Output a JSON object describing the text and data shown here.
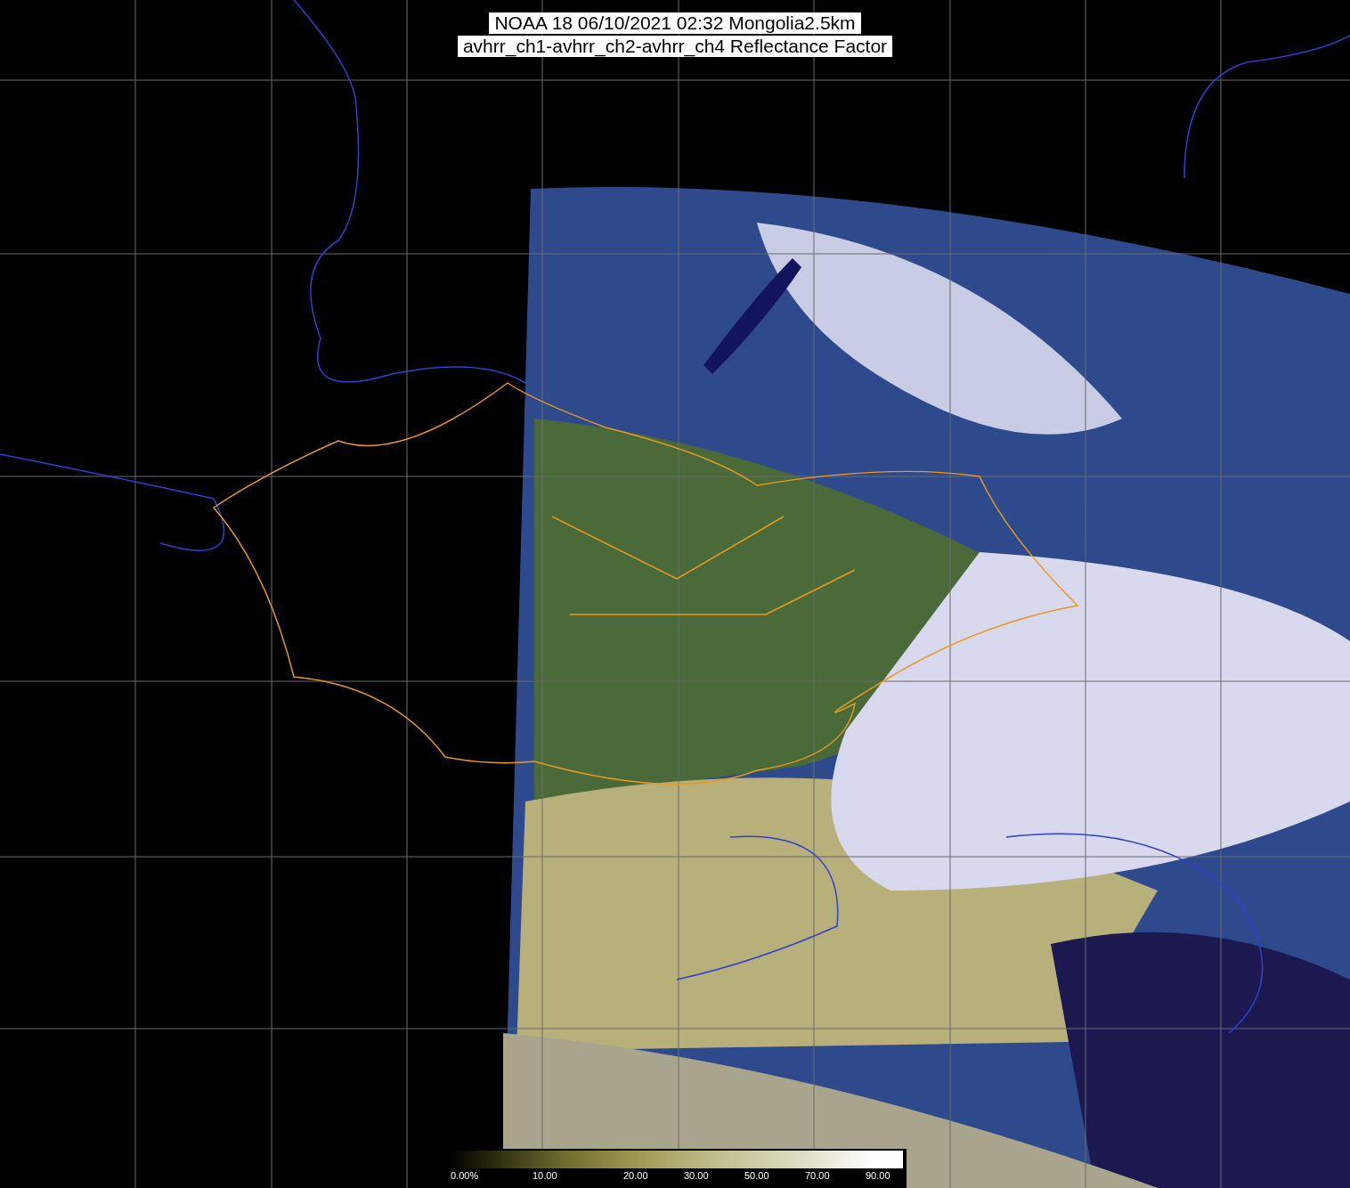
{
  "title": {
    "lines": [
      "NOAA 18 06/10/2021 02:32 Mongolia2.5km",
      "avhrr_ch1-avhrr_ch2-avhrr_ch4 Reflectance Factor"
    ]
  },
  "legend": {
    "ticks": [
      "0.00%",
      "10.00",
      "20.00",
      "30.00",
      "50.00",
      "70.00",
      "90.00"
    ]
  }
}
